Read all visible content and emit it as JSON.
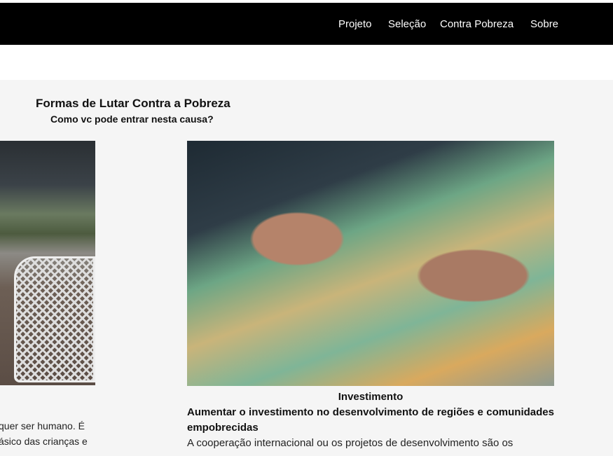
{
  "nav": {
    "items": [
      "Projeto",
      "Seleção",
      "Contra Pobreza",
      "Sobre"
    ]
  },
  "section": {
    "title": "Formas de Lutar Contra a Pobreza",
    "subtitle": "Como vc pode entrar nesta causa?"
  },
  "left_card": {
    "text_lines": [
      "quer ser humano. É",
      "ásico das crianças e"
    ]
  },
  "right_card": {
    "caption": "Investimento",
    "heading": "Aumentar o investimento no desenvolvimento de regiões e comunidades empobrecidas",
    "body": "A cooperação internacional ou os projetos de desenvolvimento são os"
  }
}
